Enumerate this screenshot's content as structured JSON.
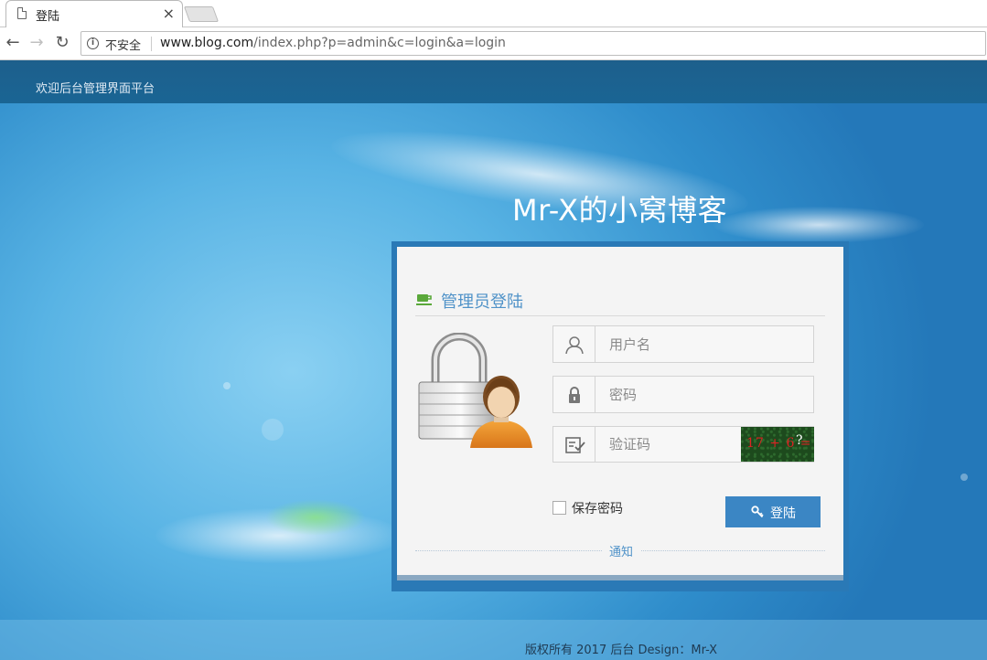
{
  "browser": {
    "tab_title": "登陆",
    "tab_close": "×",
    "security_label": "不安全",
    "url_host": "www.blog.com",
    "url_path": "/index.php?p=admin&c=login&a=login"
  },
  "header": {
    "welcome": "欢迎后台管理界面平台"
  },
  "site_title": "Mr-X的小窝博客",
  "login": {
    "heading": "管理员登陆",
    "username_placeholder": "用户名",
    "password_placeholder": "密码",
    "captcha_placeholder": "验证码",
    "captcha_text": "17 + 6 =",
    "captcha_question": "?",
    "remember_label": "保存密码",
    "login_button": "登陆",
    "notice": "通知"
  },
  "footer": {
    "copyright": "版权所有 2017 后台 Design：Mr-X"
  },
  "colors": {
    "panel_border": "#2a79b6",
    "accent": "#4f92c8",
    "button": "#3b86c4",
    "topbar": "#1d5f8c"
  },
  "icons": [
    "document-icon",
    "close-icon",
    "back-icon",
    "forward-icon",
    "reload-icon",
    "info-icon",
    "cup-icon",
    "lock-user-icon",
    "user-icon",
    "lock-icon",
    "captcha-icon",
    "key-icon"
  ]
}
